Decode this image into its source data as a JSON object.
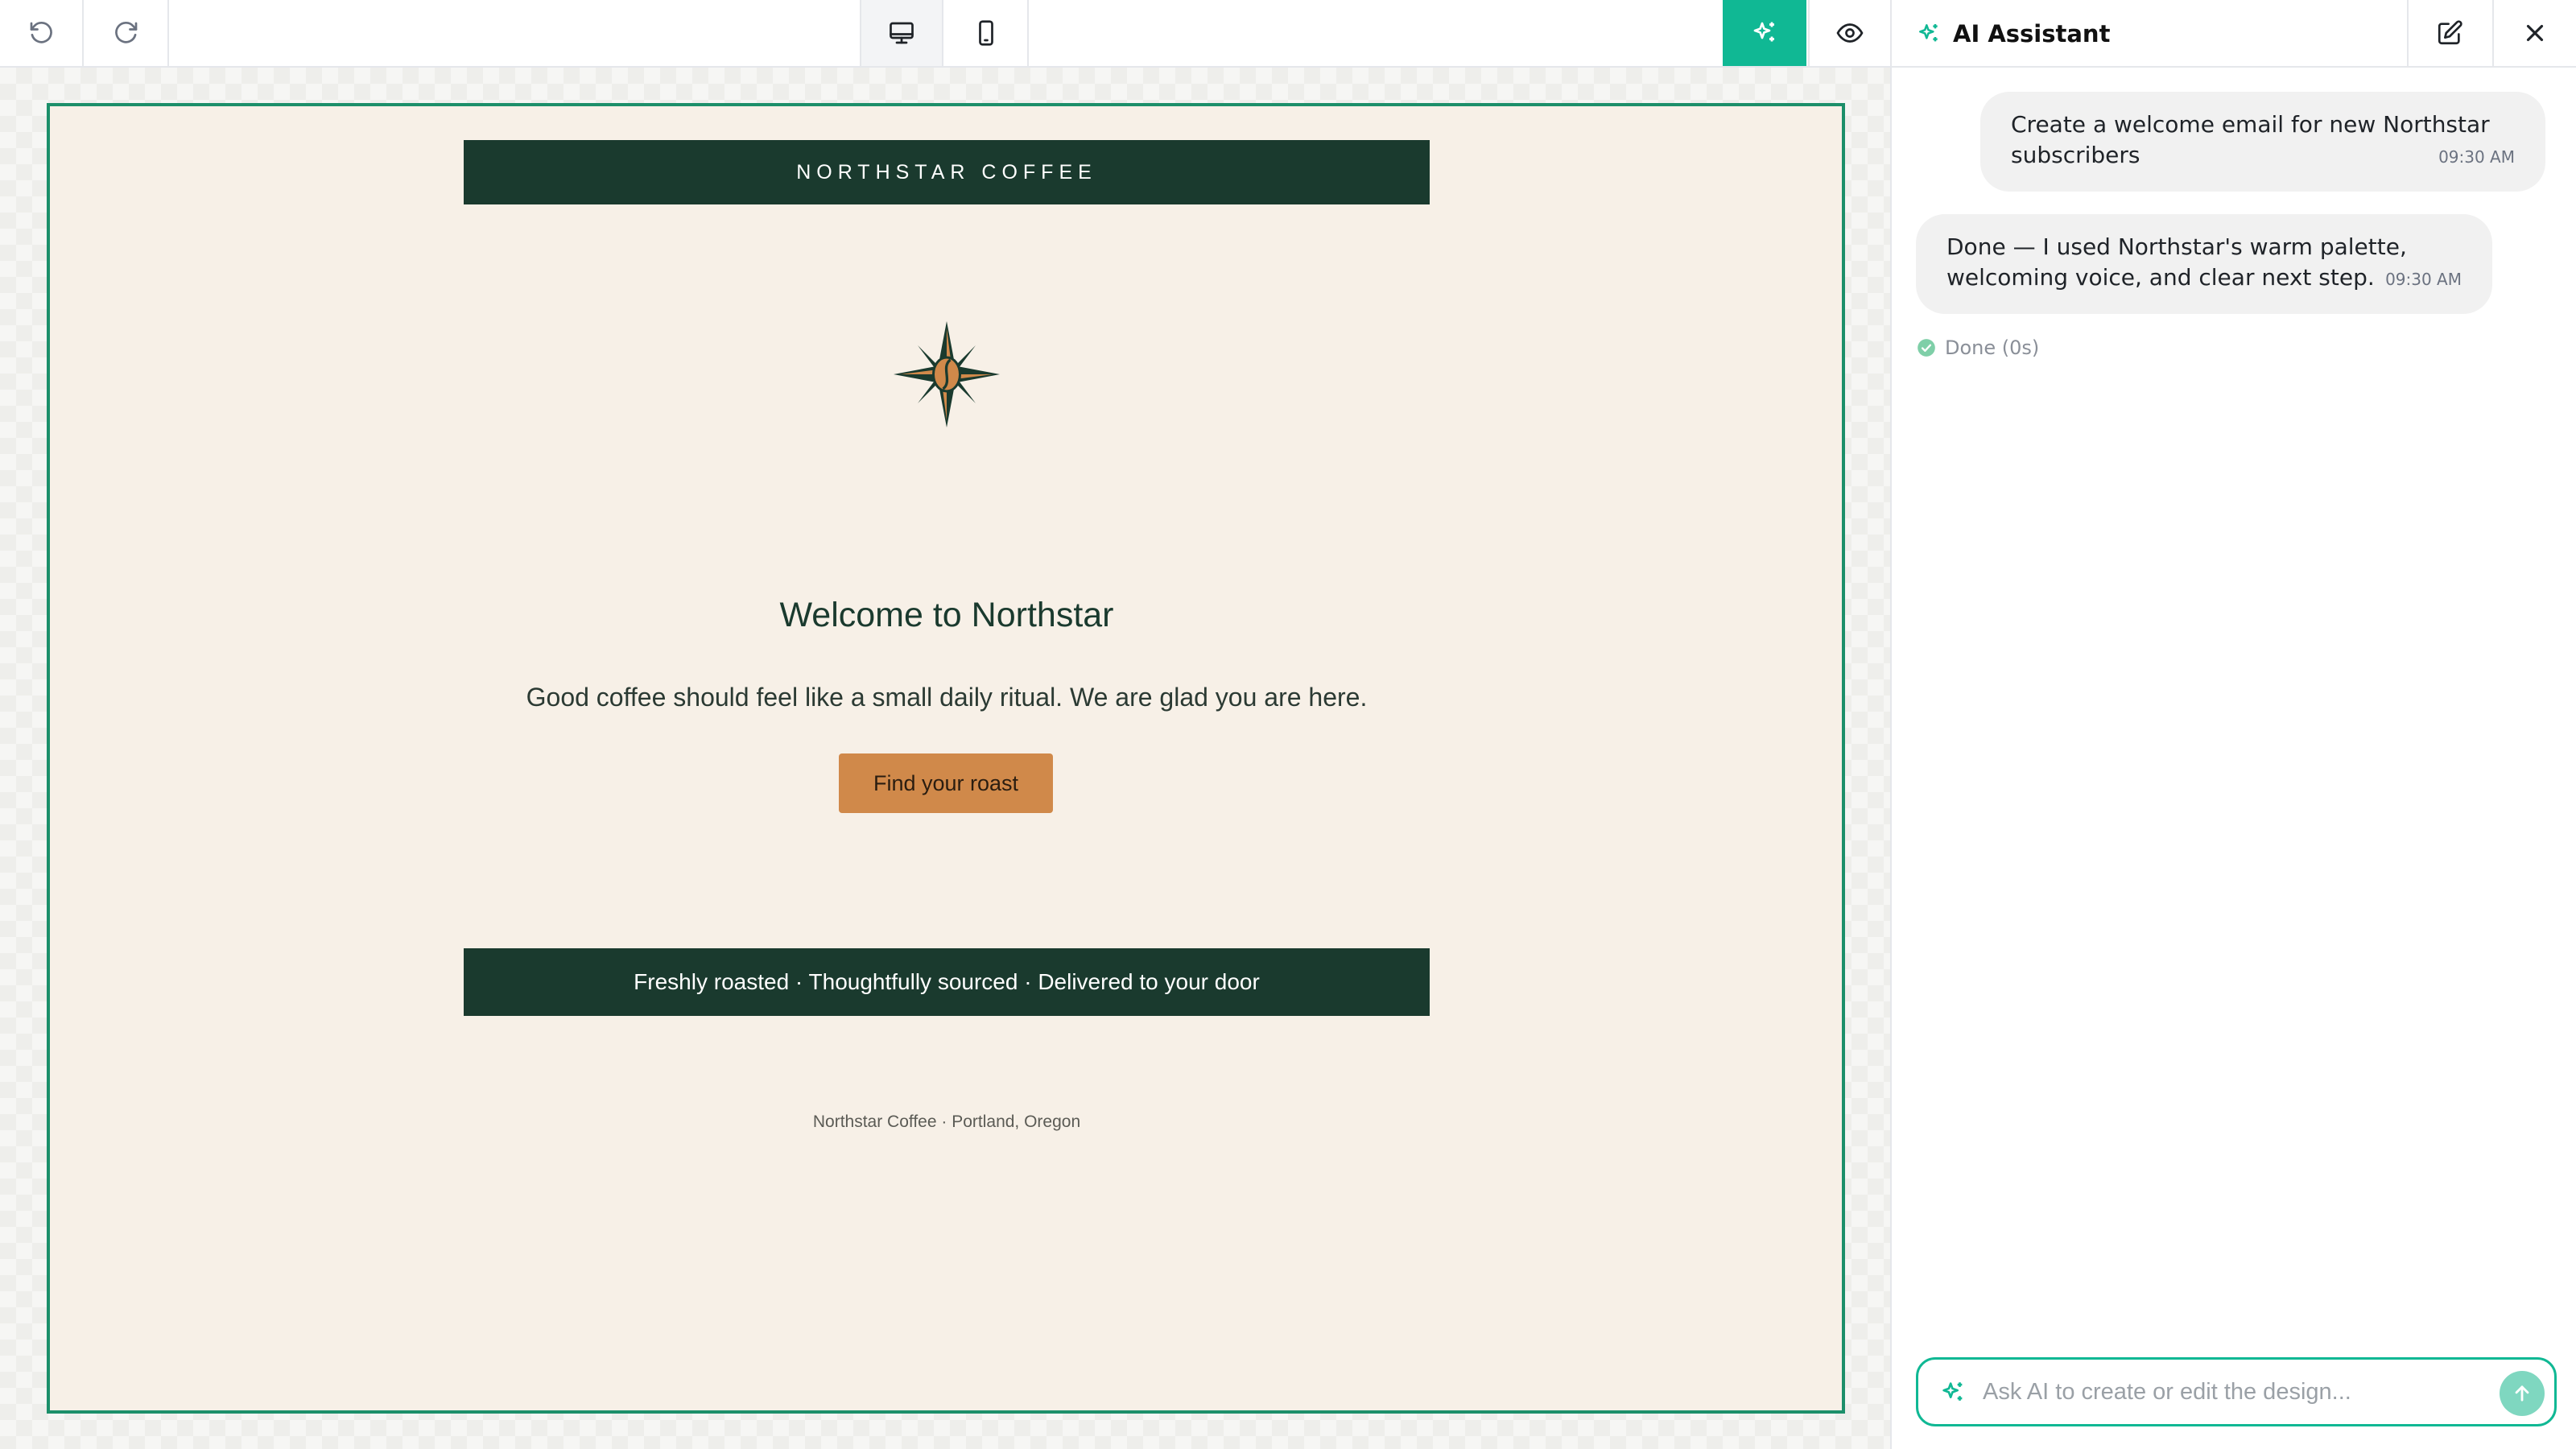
{
  "toolbar": {
    "undo_icon": "undo-icon",
    "redo_icon": "redo-icon",
    "desktop_icon": "desktop-icon",
    "mobile_icon": "mobile-icon",
    "ai_icon": "sparkles-icon",
    "preview_icon": "eye-icon"
  },
  "email": {
    "brand": "NORTHSTAR COFFEE",
    "headline": "Welcome to Northstar",
    "subtext": "Good coffee should feel like a small daily ritual. We are glad you are here.",
    "cta_label": "Find your roast",
    "tagline": "Freshly roasted · Thoughtfully sourced · Delivered to your door",
    "footer": "Northstar Coffee · Portland, Oregon",
    "logo_icon": "compass-star-coffee-bean-logo"
  },
  "assistant": {
    "title": "AI Assistant",
    "messages": [
      {
        "role": "user",
        "text": "Create a welcome email for new Northstar subscribers",
        "time": "09:30 AM"
      },
      {
        "role": "assistant",
        "text": "Done — I used Northstar's warm palette, welcoming voice, and clear next step.",
        "time": "09:30 AM"
      }
    ],
    "status": "Done (0s)",
    "input_placeholder": "Ask AI to create or edit the design..."
  },
  "colors": {
    "accent": "#10b894",
    "email_background": "#f7f0e7",
    "brand_dark": "#1a3a2e",
    "cta": "#d0894a",
    "frame_border": "#1c8f6a"
  }
}
